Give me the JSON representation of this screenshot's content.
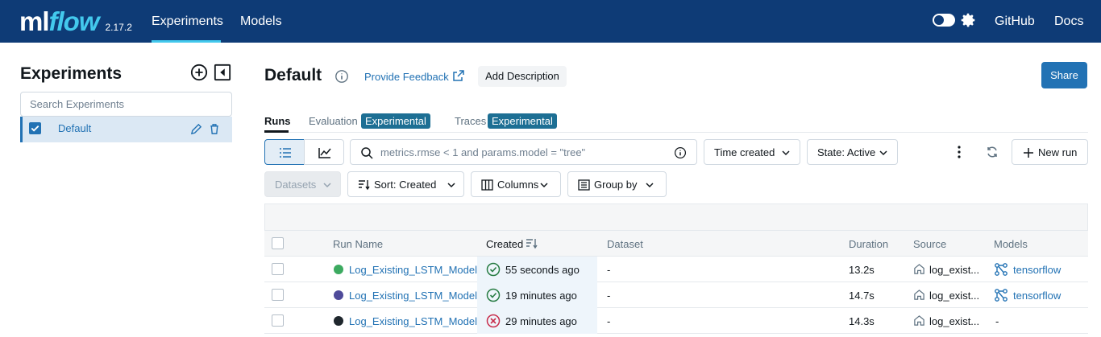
{
  "brand": {
    "logo_ml": "ml",
    "logo_flow": "flow",
    "version": "2.17.2"
  },
  "nav": {
    "experiments": "Experiments",
    "models": "Models",
    "github": "GitHub",
    "docs": "Docs"
  },
  "sidebar": {
    "title": "Experiments",
    "search_placeholder": "Search Experiments",
    "items": [
      {
        "label": "Default",
        "checked": true
      }
    ]
  },
  "header": {
    "title": "Default",
    "feedback": "Provide Feedback",
    "add_description": "Add Description",
    "share": "Share"
  },
  "tabs": [
    {
      "label": "Runs"
    },
    {
      "label": "Evaluation",
      "badge": "Experimental"
    },
    {
      "label": "Traces",
      "badge": "Experimental"
    }
  ],
  "toolbar": {
    "filter_placeholder": "metrics.rmse < 1 and params.model = \"tree\"",
    "time_created": "Time created",
    "state": "State: Active",
    "new_run": "New run",
    "datasets": "Datasets",
    "sort": "Sort: Created",
    "columns": "Columns",
    "group_by": "Group by"
  },
  "table": {
    "columns": [
      "Run Name",
      "Created",
      "Dataset",
      "Duration",
      "Source",
      "Models"
    ],
    "rows": [
      {
        "color": "#3caa60",
        "name": "Log_Existing_LSTM_Model",
        "status": "success",
        "created": "55 seconds ago",
        "dataset": "-",
        "duration": "13.2s",
        "source": "log_exist...",
        "model": "tensorflow"
      },
      {
        "color": "#4f4b9a",
        "name": "Log_Existing_LSTM_Model",
        "status": "success",
        "created": "19 minutes ago",
        "dataset": "-",
        "duration": "14.7s",
        "source": "log_exist...",
        "model": "tensorflow"
      },
      {
        "color": "#1f272d",
        "name": "Log_Existing_LSTM_Model",
        "status": "failed",
        "created": "29 minutes ago",
        "dataset": "-",
        "duration": "14.3s",
        "source": "log_exist...",
        "model": "-"
      }
    ]
  },
  "colors": {
    "topbar": "#0e3b76",
    "accent": "#2272b4",
    "badge": "#1d6f94",
    "success": "#277c43",
    "failed": "#c82d4c"
  }
}
